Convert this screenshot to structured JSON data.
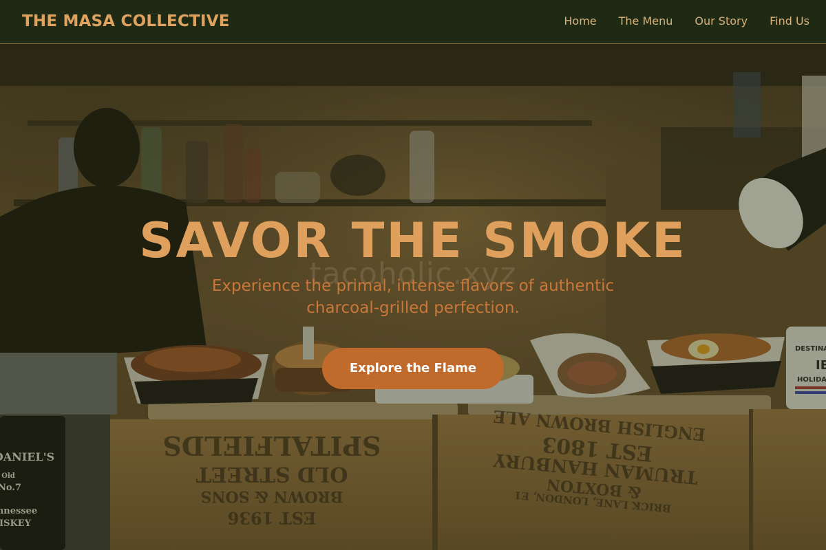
{
  "nav": {
    "brand": "THE MASA COLLECTIVE",
    "links": [
      {
        "label": "Home"
      },
      {
        "label": "The Menu"
      },
      {
        "label": "Our Story"
      },
      {
        "label": "Find Us"
      }
    ]
  },
  "hero": {
    "title": "SAVOR THE SMOKE",
    "subtitle": "Experience the primal, intense flavors of authentic charcoal-grilled perfection.",
    "watermark": "tacoholic.xyz",
    "cta_label": "Explore the Flame"
  },
  "crates": {
    "left": [
      "EST 1936",
      "BROWN & SONS",
      "OLD STREET",
      "SPITALFIELDS"
    ],
    "right": [
      "BRICK LANE, LONDON, E1",
      "& BOXTON",
      "TRUMAN HANBURY",
      "EST 1803",
      "ENGLISH BROWN ALE"
    ]
  },
  "bottle_label": [
    "DANIEL'S",
    "Old",
    "No.7",
    "nnessee",
    "ISKEY"
  ],
  "mug_label": [
    "DESTINAT",
    "IE",
    "HOLIDA"
  ],
  "colors": {
    "nav_bg": "#1f2a14",
    "brand": "#dfa35f",
    "nav_link": "#d9b27a",
    "title": "#dfa05e",
    "subtitle": "#c9773a",
    "cta_bg": "#c06a2b",
    "cta_text": "#ffffff"
  }
}
